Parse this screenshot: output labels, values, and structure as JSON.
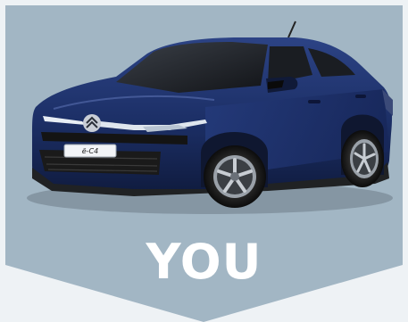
{
  "banner": {
    "headline": "YOU",
    "badge_text": "ë-C4",
    "colors": {
      "panel_background": "#a2b6c4",
      "page_background": "#eef2f5",
      "car_body": "#1c2f66",
      "headline": "#ffffff"
    },
    "image": {
      "subject": "car-photo",
      "brand_logo": "citroen-logo-icon"
    }
  }
}
